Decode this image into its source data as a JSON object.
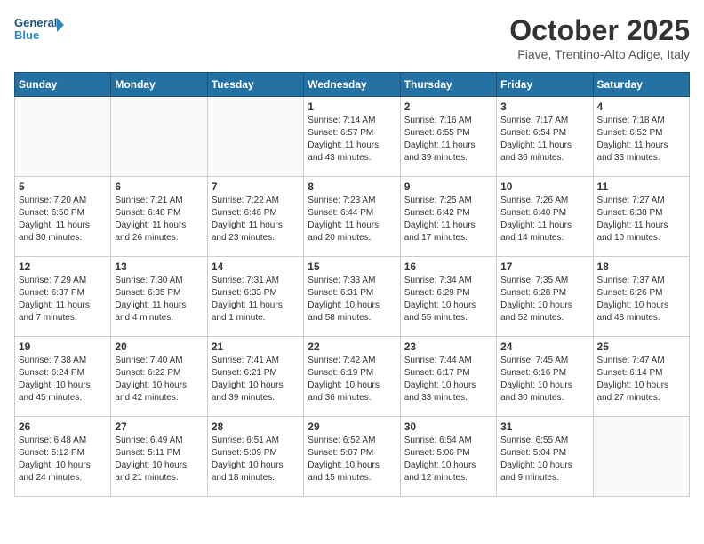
{
  "logo": {
    "line1": "General",
    "line2": "Blue"
  },
  "title": "October 2025",
  "subtitle": "Fiave, Trentino-Alto Adige, Italy",
  "weekdays": [
    "Sunday",
    "Monday",
    "Tuesday",
    "Wednesday",
    "Thursday",
    "Friday",
    "Saturday"
  ],
  "weeks": [
    [
      {
        "day": "",
        "info": ""
      },
      {
        "day": "",
        "info": ""
      },
      {
        "day": "",
        "info": ""
      },
      {
        "day": "1",
        "info": "Sunrise: 7:14 AM\nSunset: 6:57 PM\nDaylight: 11 hours\nand 43 minutes."
      },
      {
        "day": "2",
        "info": "Sunrise: 7:16 AM\nSunset: 6:55 PM\nDaylight: 11 hours\nand 39 minutes."
      },
      {
        "day": "3",
        "info": "Sunrise: 7:17 AM\nSunset: 6:54 PM\nDaylight: 11 hours\nand 36 minutes."
      },
      {
        "day": "4",
        "info": "Sunrise: 7:18 AM\nSunset: 6:52 PM\nDaylight: 11 hours\nand 33 minutes."
      }
    ],
    [
      {
        "day": "5",
        "info": "Sunrise: 7:20 AM\nSunset: 6:50 PM\nDaylight: 11 hours\nand 30 minutes."
      },
      {
        "day": "6",
        "info": "Sunrise: 7:21 AM\nSunset: 6:48 PM\nDaylight: 11 hours\nand 26 minutes."
      },
      {
        "day": "7",
        "info": "Sunrise: 7:22 AM\nSunset: 6:46 PM\nDaylight: 11 hours\nand 23 minutes."
      },
      {
        "day": "8",
        "info": "Sunrise: 7:23 AM\nSunset: 6:44 PM\nDaylight: 11 hours\nand 20 minutes."
      },
      {
        "day": "9",
        "info": "Sunrise: 7:25 AM\nSunset: 6:42 PM\nDaylight: 11 hours\nand 17 minutes."
      },
      {
        "day": "10",
        "info": "Sunrise: 7:26 AM\nSunset: 6:40 PM\nDaylight: 11 hours\nand 14 minutes."
      },
      {
        "day": "11",
        "info": "Sunrise: 7:27 AM\nSunset: 6:38 PM\nDaylight: 11 hours\nand 10 minutes."
      }
    ],
    [
      {
        "day": "12",
        "info": "Sunrise: 7:29 AM\nSunset: 6:37 PM\nDaylight: 11 hours\nand 7 minutes."
      },
      {
        "day": "13",
        "info": "Sunrise: 7:30 AM\nSunset: 6:35 PM\nDaylight: 11 hours\nand 4 minutes."
      },
      {
        "day": "14",
        "info": "Sunrise: 7:31 AM\nSunset: 6:33 PM\nDaylight: 11 hours\nand 1 minute."
      },
      {
        "day": "15",
        "info": "Sunrise: 7:33 AM\nSunset: 6:31 PM\nDaylight: 10 hours\nand 58 minutes."
      },
      {
        "day": "16",
        "info": "Sunrise: 7:34 AM\nSunset: 6:29 PM\nDaylight: 10 hours\nand 55 minutes."
      },
      {
        "day": "17",
        "info": "Sunrise: 7:35 AM\nSunset: 6:28 PM\nDaylight: 10 hours\nand 52 minutes."
      },
      {
        "day": "18",
        "info": "Sunrise: 7:37 AM\nSunset: 6:26 PM\nDaylight: 10 hours\nand 48 minutes."
      }
    ],
    [
      {
        "day": "19",
        "info": "Sunrise: 7:38 AM\nSunset: 6:24 PM\nDaylight: 10 hours\nand 45 minutes."
      },
      {
        "day": "20",
        "info": "Sunrise: 7:40 AM\nSunset: 6:22 PM\nDaylight: 10 hours\nand 42 minutes."
      },
      {
        "day": "21",
        "info": "Sunrise: 7:41 AM\nSunset: 6:21 PM\nDaylight: 10 hours\nand 39 minutes."
      },
      {
        "day": "22",
        "info": "Sunrise: 7:42 AM\nSunset: 6:19 PM\nDaylight: 10 hours\nand 36 minutes."
      },
      {
        "day": "23",
        "info": "Sunrise: 7:44 AM\nSunset: 6:17 PM\nDaylight: 10 hours\nand 33 minutes."
      },
      {
        "day": "24",
        "info": "Sunrise: 7:45 AM\nSunset: 6:16 PM\nDaylight: 10 hours\nand 30 minutes."
      },
      {
        "day": "25",
        "info": "Sunrise: 7:47 AM\nSunset: 6:14 PM\nDaylight: 10 hours\nand 27 minutes."
      }
    ],
    [
      {
        "day": "26",
        "info": "Sunrise: 6:48 AM\nSunset: 5:12 PM\nDaylight: 10 hours\nand 24 minutes."
      },
      {
        "day": "27",
        "info": "Sunrise: 6:49 AM\nSunset: 5:11 PM\nDaylight: 10 hours\nand 21 minutes."
      },
      {
        "day": "28",
        "info": "Sunrise: 6:51 AM\nSunset: 5:09 PM\nDaylight: 10 hours\nand 18 minutes."
      },
      {
        "day": "29",
        "info": "Sunrise: 6:52 AM\nSunset: 5:07 PM\nDaylight: 10 hours\nand 15 minutes."
      },
      {
        "day": "30",
        "info": "Sunrise: 6:54 AM\nSunset: 5:06 PM\nDaylight: 10 hours\nand 12 minutes."
      },
      {
        "day": "31",
        "info": "Sunrise: 6:55 AM\nSunset: 5:04 PM\nDaylight: 10 hours\nand 9 minutes."
      },
      {
        "day": "",
        "info": ""
      }
    ]
  ]
}
